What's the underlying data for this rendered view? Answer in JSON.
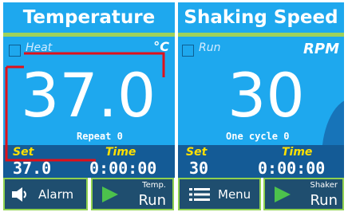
{
  "temperature": {
    "title": "Temperature",
    "checkbox_label": "Heat",
    "unit": "°C",
    "current_value": "37.0",
    "repeat_label": "Repeat",
    "repeat_value": "0",
    "set_label": "Set",
    "time_label": "Time",
    "set_value": "37.0",
    "time_value": "0:00:00"
  },
  "shaking": {
    "title": "Shaking Speed",
    "checkbox_label": "Run",
    "unit": "RPM",
    "current_value": "30",
    "cycle_label": "One cycle",
    "cycle_value": "0",
    "set_label": "Set",
    "time_label": "Time",
    "set_value": "30",
    "time_value": "0:00:00"
  },
  "buttons": {
    "alarm": "Alarm",
    "temp_run_top": "Temp.",
    "temp_run_bottom": "Run",
    "menu": "Menu",
    "shaker_run_top": "Shaker",
    "shaker_run_bottom": "Run"
  },
  "colors": {
    "panel": "#1ea8ee",
    "set_bar": "#145b96",
    "button": "#1f4e6f",
    "accent_green": "#8fd14f",
    "label_yellow": "#ffe000",
    "annotation_red": "#e0101a"
  }
}
